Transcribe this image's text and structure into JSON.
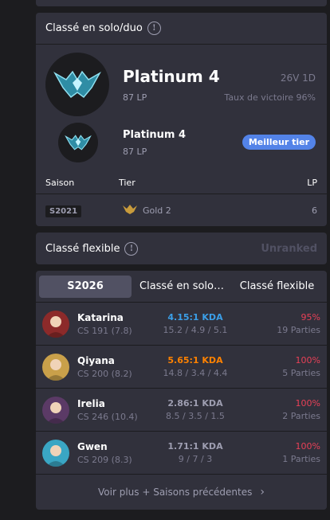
{
  "solo": {
    "title": "Classé en solo/duo",
    "current": {
      "tier": "Platinum 4",
      "lp": "87 LP",
      "record": "26V 1D",
      "winrate": "Taux de victoire 96%"
    },
    "peak": {
      "tier": "Platinum 4",
      "lp": "87 LP",
      "badge": "Meilleur tier"
    },
    "season_header": {
      "season": "Saison",
      "tier": "Tier",
      "lp": "LP"
    },
    "seasons": [
      {
        "season": "S2021",
        "tier": "Gold 2",
        "lp": "6"
      }
    ]
  },
  "flex": {
    "title": "Classé flexible",
    "status": "Unranked"
  },
  "champions": {
    "tabs": [
      "S2026",
      "Classé en solo…",
      "Classé flexible"
    ],
    "rows": [
      {
        "name": "Katarina",
        "cs": "CS 191 (7.8)",
        "kda": "4.15:1 KDA",
        "kda_color": "#3b9fe8",
        "detail": "15.2 / 4.9 / 5.1",
        "winrate": "95%",
        "games": "19 Parties",
        "avatar_color": "#8c2a2a"
      },
      {
        "name": "Qiyana",
        "cs": "CS 200 (8.2)",
        "kda": "5.65:1 KDA",
        "kda_color": "#ff8200",
        "detail": "14.8 / 3.4 / 4.4",
        "winrate": "100%",
        "games": "5 Parties",
        "avatar_color": "#c9a04a"
      },
      {
        "name": "Irelia",
        "cs": "CS 246 (10.4)",
        "kda": "2.86:1 KDA",
        "kda_color": "#9e9eb1",
        "detail": "8.5 / 3.5 / 1.5",
        "winrate": "100%",
        "games": "2 Parties",
        "avatar_color": "#5b3a66"
      },
      {
        "name": "Gwen",
        "cs": "CS 209 (8.3)",
        "kda": "1.71:1 KDA",
        "kda_color": "#9e9eb1",
        "detail": "9 / 7 / 3",
        "winrate": "100%",
        "games": "1 Parties",
        "avatar_color": "#3aa6c4"
      }
    ],
    "more_label": "Voir plus + Saisons précédentes"
  }
}
